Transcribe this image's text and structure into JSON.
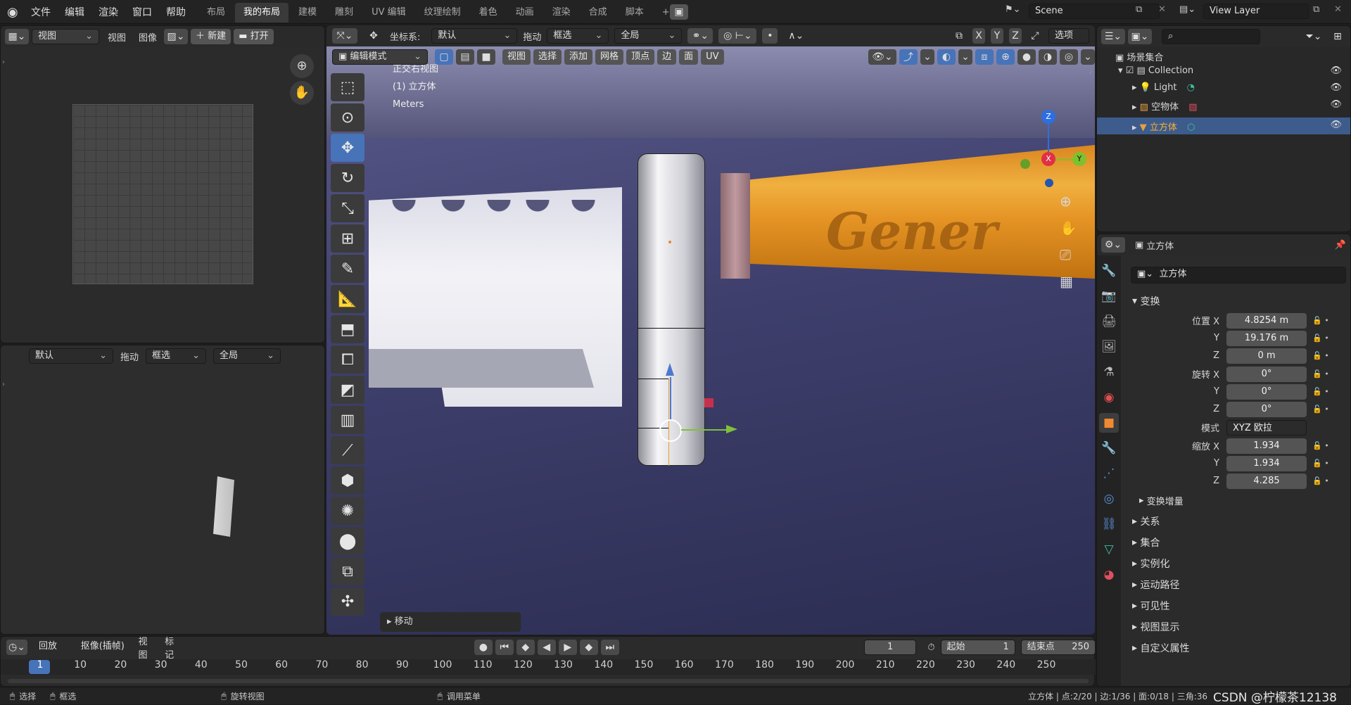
{
  "menu": [
    "文件",
    "编辑",
    "渲染",
    "窗口",
    "帮助"
  ],
  "tabs": [
    "布局",
    "我的布局",
    "建模",
    "雕刻",
    "UV 编辑",
    "纹理绘制",
    "着色",
    "动画",
    "渲染",
    "合成",
    "脚本"
  ],
  "scene": "Scene",
  "view_layer": "View Layer",
  "image_editor": {
    "view_label": "视图",
    "menu_view": "视图",
    "menu_image": "图像",
    "new": "新建",
    "open": "打开"
  },
  "left_lower": {
    "pivot": "默认",
    "drag": "拖动",
    "select": "框选",
    "orient": "全局"
  },
  "viewport": {
    "coord_label": "坐标系:",
    "orientation": "默认",
    "drag": "拖动",
    "select": "框选",
    "transform": "全局",
    "options": "选项",
    "mode": "编辑模式",
    "menus": [
      "视图",
      "选择",
      "添加",
      "网格",
      "顶点",
      "边",
      "面",
      "UV"
    ],
    "info_view": "正交右视图",
    "info_object": "(1) 立方体",
    "info_units": "Meters",
    "operator_panel": "移动",
    "axes": [
      "X",
      "Y",
      "Z"
    ],
    "handle_text": "Gener"
  },
  "outliner": {
    "root": "场景集合",
    "collection": "Collection",
    "items": [
      "Light",
      "空物体",
      "立方体"
    ]
  },
  "properties": {
    "object_name": "立方体",
    "data_name": "立方体",
    "transform_title": "变换",
    "rows": [
      {
        "label": "位置 X",
        "value": "4.8254 m"
      },
      {
        "label": "Y",
        "value": "19.176 m"
      },
      {
        "label": "Z",
        "value": "0 m"
      },
      {
        "label": "旋转 X",
        "value": "0°"
      },
      {
        "label": "Y",
        "value": "0°"
      },
      {
        "label": "Z",
        "value": "0°"
      },
      {
        "label": "模式",
        "value": "XYZ 欧拉"
      },
      {
        "label": "缩放 X",
        "value": "1.934"
      },
      {
        "label": "Y",
        "value": "1.934"
      },
      {
        "label": "Z",
        "value": "4.285"
      }
    ],
    "delta": "变换增量",
    "sections": [
      "关系",
      "集合",
      "实例化",
      "运动路径",
      "可见性",
      "视图显示",
      "自定义属性"
    ]
  },
  "timeline": {
    "playback": "回放",
    "keying": "抠像(插帧)",
    "view": "视图",
    "marker": "标记",
    "current": "1",
    "start_label": "起始",
    "start": "1",
    "end_label": "结束点",
    "end": "250",
    "ticks": [
      "1",
      "10",
      "20",
      "30",
      "40",
      "50",
      "60",
      "70",
      "80",
      "90",
      "100",
      "110",
      "120",
      "130",
      "140",
      "150",
      "160",
      "170",
      "180",
      "190",
      "200",
      "210",
      "220",
      "230",
      "240",
      "250"
    ]
  },
  "status": {
    "select": "选择",
    "box": "框选",
    "rotate": "旋转视图",
    "menu": "调用菜单",
    "stats": "立方体 | 点:2/20 | 边:1/36 | 面:0/18 | 三角:36",
    "watermark": "CSDN @柠檬茶12138"
  }
}
